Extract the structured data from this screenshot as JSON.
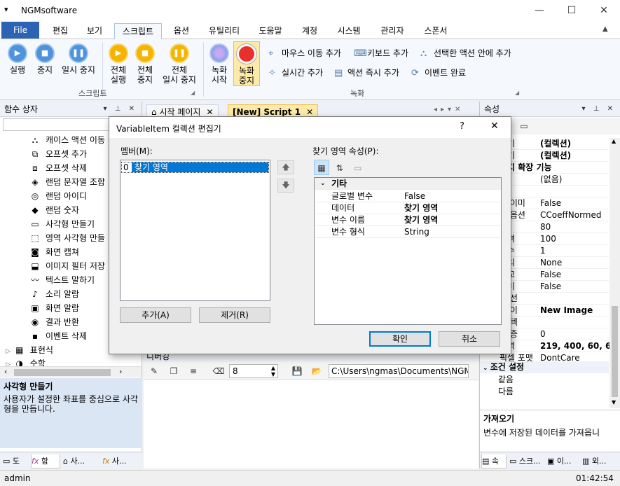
{
  "window": {
    "title": "NGMsoftware",
    "system_icon": "menu-icon",
    "min": "—",
    "max": "☐",
    "close": "✕"
  },
  "menu": {
    "file": "File",
    "tabs": [
      "편집",
      "보기",
      "스크립트",
      "옵션",
      "유틸리티",
      "도움말",
      "계정",
      "시스템",
      "관리자",
      "스폰서"
    ],
    "active": "스크립트"
  },
  "ribbon": {
    "script_group_label": "스크립트",
    "record_group_label": "녹화",
    "run": "실행",
    "stop": "중지",
    "pause": "일시 중지",
    "run_all": [
      "전체",
      "실행"
    ],
    "stop_all": [
      "전체",
      "중지"
    ],
    "pause_all": [
      "전체",
      "일시 중지"
    ],
    "rec_start": [
      "녹화",
      "시작"
    ],
    "rec_stop": [
      "녹화",
      "중지"
    ],
    "add_mouse": "마우스 이동 추가",
    "add_keyboard": "키보드 추가",
    "add_in_selected": "선택한 액션 안에 추가",
    "add_realtime": "실시간 추가",
    "add_action_immediate": "액션 즉시 추가",
    "event_done": "이벤트 완료"
  },
  "left_panel": {
    "title": "함수 상자",
    "items": [
      "캐이스 액션 이동",
      "오프셋 추가",
      "오프셋 삭제",
      "랜덤 문자열 조합",
      "랜덤 아이디",
      "랜덤 숫자",
      "사각형 만들기",
      "영역 사각형 만들",
      "화면 캡쳐",
      "이미지 필터 저장",
      "텍스트 말하기",
      "소리 알람",
      "화면 알람",
      "결과 반환",
      "이벤트 삭제"
    ],
    "icons": [
      "tree-icon",
      "offset-add-icon",
      "offset-delete-icon",
      "random-string-icon",
      "random-id-icon",
      "random-number-icon",
      "rectangle-icon",
      "region-rect-icon",
      "camera-icon",
      "image-filter-icon",
      "speech-icon",
      "sound-alarm-icon",
      "screen-alarm-icon",
      "result-return-icon",
      "event-delete-icon"
    ],
    "group_expression": "표현식",
    "group_math": "수학",
    "desc_title": "사각형 만들기",
    "desc_text": "사용자가 설정한 좌표를 중심으로 사각형을 만듭니다.",
    "bottom_tabs": [
      "도",
      "함",
      "사...",
      "사..."
    ]
  },
  "doc": {
    "tabs": [
      "시작 페이지",
      "[New] Script 1"
    ],
    "output_label": "디버깅",
    "number_value": "8",
    "path_value": "C:\\Users\\ngmas\\Documents\\NGM6\\"
  },
  "right_panel": {
    "title": "속성",
    "rows": [
      [
        "오기",
        "(컬렉션)",
        true
      ],
      [
        "하기",
        "(컬렉션)",
        true
      ],
      [
        "미지 확장 기능",
        "",
        true
      ],
      [
        "",
        "(없음)",
        false
      ],
      [
        "",
        "",
        false
      ],
      [
        "양 이미",
        "False",
        false
      ],
      [
        "이 옵션",
        "CCoeffNormed",
        false
      ],
      [
        "율",
        "80",
        false
      ],
      [
        "간격",
        "100",
        false
      ],
      [
        "회수",
        "1",
        false
      ],
      [
        "처리",
        "None",
        false
      ],
      [
        "비교",
        "False",
        false
      ],
      [
        "이미",
        "False",
        false
      ],
      [
        "지 선",
        "",
        false
      ],
      [
        "지 이",
        "New Image",
        true
      ],
      [
        "지 텍",
        "",
        false
      ],
      [
        "도 증",
        "0",
        false
      ],
      [
        "영역",
        "219, 400, 60, 6",
        true
      ],
      [
        "픽셀 포맷",
        "DontCare",
        false
      ]
    ],
    "section_condition": "조건 설정",
    "cond_rows": [
      "같음",
      "다름"
    ],
    "desc_title": "가져오기",
    "desc_text": "변수에 저장된 데이터를 가져옵니",
    "bottom_tabs": [
      "속",
      "스크...",
      "이...",
      "외..."
    ]
  },
  "dialog": {
    "title": "VariableItem 컬렉션 편집기",
    "help": "?",
    "close": "✕",
    "members_label": "멤버(M):",
    "members": [
      {
        "index": "0",
        "name": "찾기 영역"
      }
    ],
    "props_label": "찾기 영역 속성(P):",
    "category": "기타",
    "props": [
      {
        "name": "글로벌 변수",
        "value": "False",
        "bold": false
      },
      {
        "name": "데이터",
        "value": "찾기 영역",
        "bold": true
      },
      {
        "name": "변수 이름",
        "value": "찾기 영역",
        "bold": true
      },
      {
        "name": "변수 형식",
        "value": "String",
        "bold": false
      }
    ],
    "add": "추가(A)",
    "remove": "제거(R)",
    "ok": "확인",
    "cancel": "취소"
  },
  "status": {
    "user": "admin",
    "time": "01:42:54"
  }
}
